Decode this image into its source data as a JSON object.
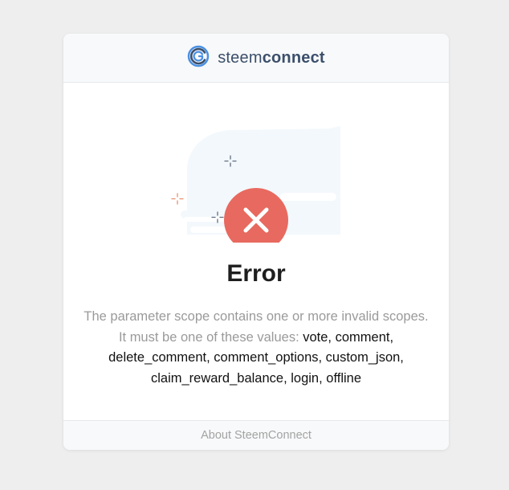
{
  "header": {
    "brand_light": "steem",
    "brand_bold": "connect"
  },
  "illustration": {
    "icon": "close-icon",
    "accent_color": "#e8695f",
    "cloud_color": "#f3f8fc",
    "sparkle_colors": [
      "#e98e6a",
      "#5f6d80"
    ]
  },
  "error": {
    "title": "Error",
    "message_line1": "The parameter scope contains one or more invalid scopes.",
    "message_prefix": "It must be one of these values: ",
    "scopes_part1": "vote, comment,",
    "scopes_part2": "delete_comment, comment_options, custom_json,",
    "scopes_part3": "claim_reward_balance, login, offline"
  },
  "footer": {
    "about_label": "About SteemConnect"
  },
  "colors": {
    "page_background": "#eeeeee",
    "title": "#1e1e1e",
    "muted_text": "#9a9a9a",
    "brand_text": "#3b4f6b"
  }
}
